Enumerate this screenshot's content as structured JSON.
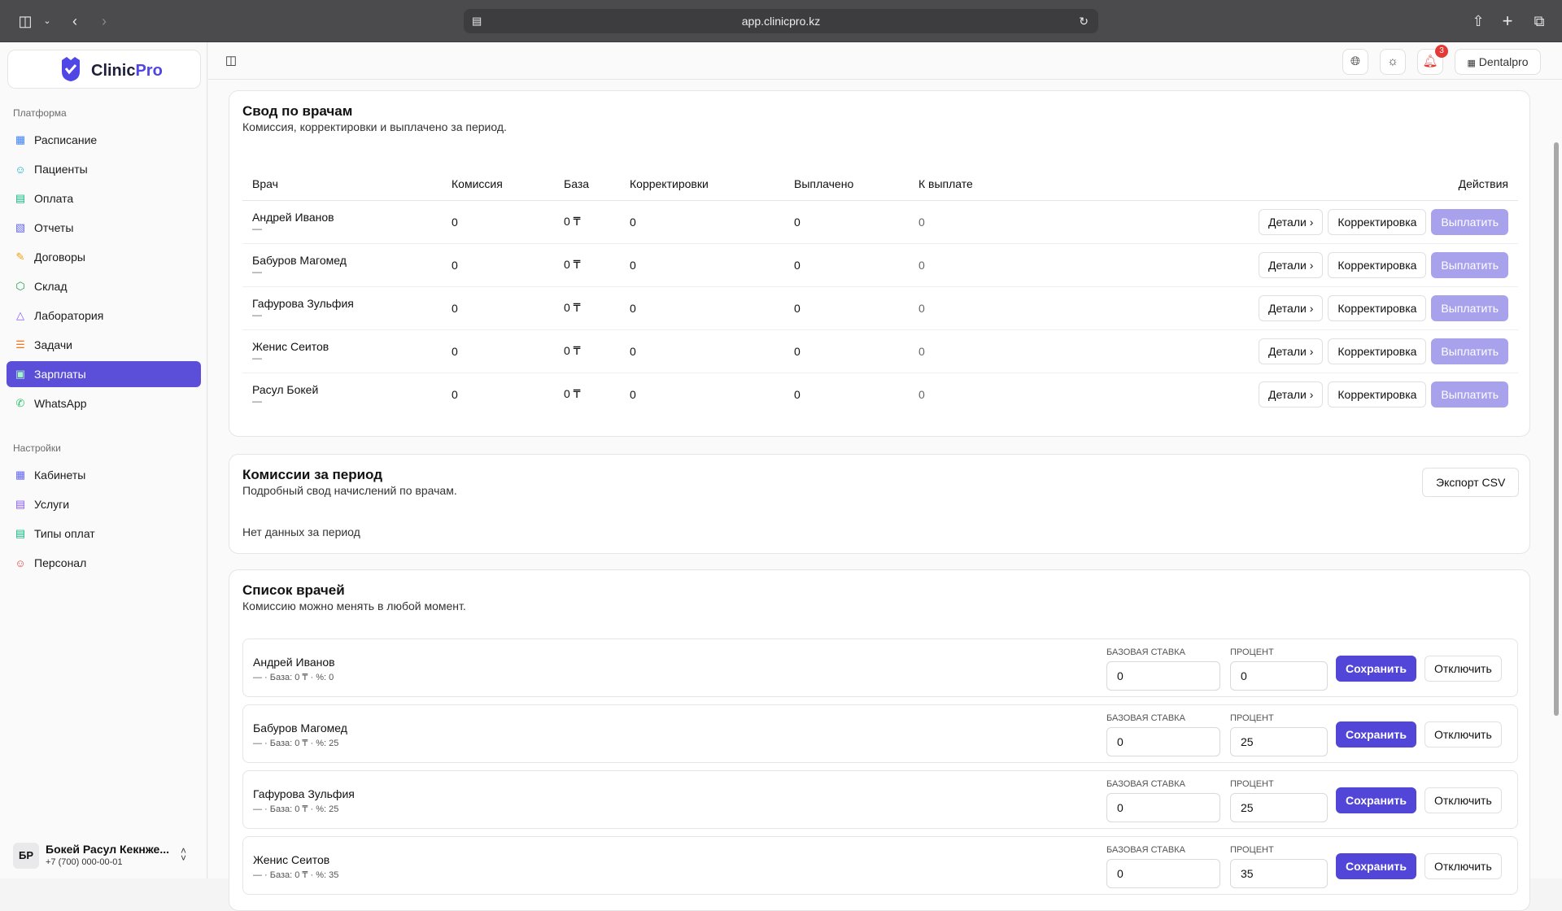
{
  "browser": {
    "url": "app.clinicpro.kz"
  },
  "app": {
    "logo_text_a": "Clinic",
    "logo_text_b": "Pro",
    "clinic_name": "Dentalpro",
    "notification_count": "3"
  },
  "sidebar": {
    "platform_label": "Платформа",
    "items": [
      {
        "label": "Расписание",
        "icon": "calendar-icon"
      },
      {
        "label": "Пациенты",
        "icon": "users-icon"
      },
      {
        "label": "Оплата",
        "icon": "card-icon"
      },
      {
        "label": "Отчеты",
        "icon": "chart-icon"
      },
      {
        "label": "Договоры",
        "icon": "contract-icon"
      },
      {
        "label": "Склад",
        "icon": "box-icon"
      },
      {
        "label": "Лаборатория",
        "icon": "flask-icon"
      },
      {
        "label": "Задачи",
        "icon": "tasks-icon"
      },
      {
        "label": "Зарплаты",
        "icon": "money-icon"
      },
      {
        "label": "WhatsApp",
        "icon": "whatsapp-icon"
      }
    ],
    "settings_label": "Настройки",
    "settings_items": [
      {
        "label": "Кабинеты",
        "icon": "map-icon"
      },
      {
        "label": "Услуги",
        "icon": "book-icon"
      },
      {
        "label": "Типы оплат",
        "icon": "card-icon"
      },
      {
        "label": "Персонал",
        "icon": "staff-icon"
      }
    ],
    "user": {
      "initials": "БР",
      "name": "Бокей Расул Кекнже...",
      "phone": "+7 (700) 000-00-01"
    }
  },
  "summary": {
    "title": "Свод по врачам",
    "subtitle": "Комиссия, корректировки и выплачено за период.",
    "headers": [
      "Врач",
      "Комиссия",
      "База",
      "Корректировки",
      "Выплачено",
      "К выплате",
      "Действия"
    ],
    "rows": [
      {
        "name": "Андрей Иванов",
        "dash": "—",
        "commission": "0",
        "base": "0 ₸",
        "adjustments": "0",
        "paid": "0",
        "due": "0"
      },
      {
        "name": "Бабуров Магомед",
        "dash": "—",
        "commission": "0",
        "base": "0 ₸",
        "adjustments": "0",
        "paid": "0",
        "due": "0"
      },
      {
        "name": "Гафурова Зульфия",
        "dash": "—",
        "commission": "0",
        "base": "0 ₸",
        "adjustments": "0",
        "paid": "0",
        "due": "0"
      },
      {
        "name": "Женис Сеитов",
        "dash": "—",
        "commission": "0",
        "base": "0 ₸",
        "adjustments": "0",
        "paid": "0",
        "due": "0"
      },
      {
        "name": "Расул Бокей",
        "dash": "—",
        "commission": "0",
        "base": "0 ₸",
        "adjustments": "0",
        "paid": "0",
        "due": "0"
      }
    ],
    "btn_details": "Детали",
    "btn_adjust": "Корректировка",
    "btn_pay": "Выплатить"
  },
  "commissions": {
    "title": "Комиссии за период",
    "subtitle": "Подробный свод начислений по врачам.",
    "export_label": "Экспорт CSV",
    "empty_text": "Нет данных за период"
  },
  "doctors": {
    "title": "Список врачей",
    "subtitle": "Комиссию можно менять в любой момент.",
    "base_label": "БАЗОВАЯ СТАВКА",
    "percent_label": "ПРОЦЕНТ",
    "save_label": "Сохранить",
    "disable_label": "Отключить",
    "rows": [
      {
        "name": "Андрей Иванов",
        "info": "— · База: 0 ₸ · %: 0",
        "base": "0",
        "percent": "0"
      },
      {
        "name": "Бабуров Магомед",
        "info": "— · База: 0 ₸ · %: 25",
        "base": "0",
        "percent": "25"
      },
      {
        "name": "Гафурова Зульфия",
        "info": "— · База: 0 ₸ · %: 25",
        "base": "0",
        "percent": "25"
      },
      {
        "name": "Женис Сеитов",
        "info": "— · База: 0 ₸ · %: 35",
        "base": "0",
        "percent": "35"
      }
    ]
  }
}
